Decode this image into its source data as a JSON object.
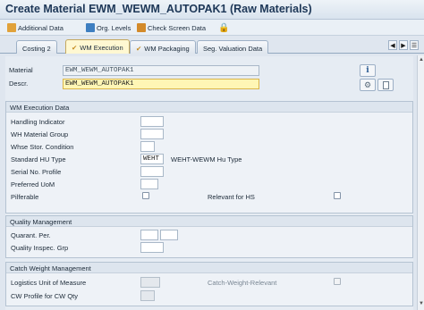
{
  "window": {
    "title": "Create Material EWM_WEWM_AUTOPAK1 (Raw Materials)"
  },
  "toolbar": {
    "additional_data": "Additional Data",
    "org_levels": "Org. Levels",
    "check_screen_data": "Check Screen Data"
  },
  "tabs": [
    {
      "label": "Costing 2"
    },
    {
      "label": "WM Execution"
    },
    {
      "label": "WM Packaging"
    },
    {
      "label": "Seg. Valuation Data"
    }
  ],
  "header": {
    "material_label": "Material",
    "material_value": "EWM_WEWM_AUTOPAK1",
    "descr_label": "Descr.",
    "descr_value": "EWM_WEWM_AUTOPAK1"
  },
  "wm_execution": {
    "title": "WM Execution Data",
    "handling_indicator": "Handling Indicator",
    "wh_material_group": "WH Material Group",
    "whse_stor_condition": "Whse Stor. Condition",
    "standard_hu_type": "Standard HU Type",
    "standard_hu_type_value": "WEHT",
    "standard_hu_type_desc": "WEHT-WEWM Hu Type",
    "serial_no_profile": "Serial No. Profile",
    "preferred_uom": "Preferred UoM",
    "pilferable": "Pilferable",
    "relevant_for_hs": "Relevant for HS"
  },
  "quality": {
    "title": "Quality Management",
    "quarant_per": "Quarant. Per.",
    "quality_inspec_grp": "Quality Inspec. Grp"
  },
  "catch_weight": {
    "title": "Catch Weight Management",
    "logistics_uom": "Logistics Unit of Measure",
    "catch_weight_relevant": "Catch-Weight-Relevant",
    "cw_profile": "CW Profile for CW Qty"
  }
}
